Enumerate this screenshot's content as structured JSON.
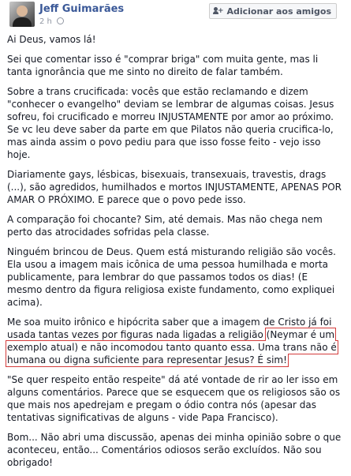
{
  "author": {
    "name": "Jeff Guimarães",
    "time": "2 h"
  },
  "header": {
    "add_friend_label": "Adicionar aos amigos"
  },
  "paragraphs": [
    "Ai Deus, vamos lá!",
    "Sei que comentar isso é \"comprar briga\" com muita gente, mas li tanta ignorância que me sinto no direito de falar também.",
    "Sobre a trans crucificada: vocês que estão reclamando e dizem \"conhecer o evangelho\" deviam se lembrar de algumas coisas. Jesus sofreu, foi crucificado e morreu INJUSTAMENTE por amor ao próximo. Se vc leu deve saber da parte em que Pilatos não queria crucifica-lo, mas ainda assim o povo pediu para que isso fosse feito - vejo isso hoje.",
    "Diariamente gays, lésbicas, bisexuais, transexuais, travestis, drags (...), são agredidos, humilhados e mortos INJUSTAMENTE, APENAS POR AMAR O PRÓXIMO. E parece que o povo pede isso.",
    "A comparação foi chocante? Sim, até demais. Mas não chega nem perto das atrocidades sofridas pela classe.",
    "Ninguém brincou de Deus. Quem está misturando religião são vocês. Ela usou a imagem mais icônica de uma pessoa humilhada e morta publicamente, para lembrar do que passamos todos os dias! (E mesmo dentro da figura religiosa existe fundamento, como expliquei acima).",
    "",
    "\"Se quer respeito então respeite\" dá até vontade de rir ao ler isso em alguns comentários. Parece que se esquecem que os religiosos são os que mais nos apedrejam e pregam o ódio contra nós (apesar das tentativas significativas de alguns - vide Papa Francisco).",
    "Bom... Não abri uma discussão, apenas dei minha opinião sobre o que aconteceu, então... Comentários odiosos serão excluídos. Não sou obrigado!"
  ],
  "p7_parts": {
    "before": "Me soa muito irônico e hipócrita saber que a imagem de Cristo já foi usada tantas vezes por figuras nada ligadas a religião ",
    "highlight": "(Neymar é um exemplo atual) e não incomodou tanto quanto essa. Uma trans não é humana ou digna suficiente para representar Jesus? É sim!"
  },
  "colors": {
    "link": "#3b5998",
    "highlight_border": "#d43c3c",
    "text": "#141823"
  }
}
